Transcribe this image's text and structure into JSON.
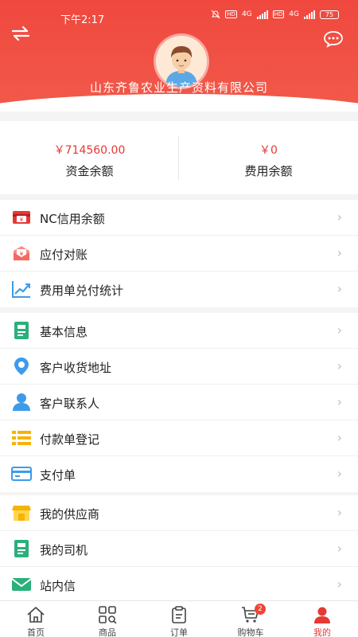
{
  "status_bar": {
    "time": "下午2:17",
    "network_a": "4G",
    "network_b": "4G",
    "battery": "75"
  },
  "profile": {
    "company_name": "山东齐鲁农业生产资料有限公司"
  },
  "balances": {
    "fund": {
      "amount": "￥714560.00",
      "label": "资金余额"
    },
    "expense": {
      "amount": "￥0",
      "label": "费用余额"
    }
  },
  "menu": {
    "group1": [
      {
        "label": "NC信用余额",
        "icon": "nc-credit-icon"
      },
      {
        "label": "应付对账",
        "icon": "payable-reconcile-icon"
      },
      {
        "label": "费用单兑付统计",
        "icon": "trend-chart-icon"
      }
    ],
    "group2": [
      {
        "label": "基本信息",
        "icon": "document-icon"
      },
      {
        "label": "客户收货地址",
        "icon": "location-pin-icon"
      },
      {
        "label": "客户联系人",
        "icon": "person-icon"
      },
      {
        "label": "付款单登记",
        "icon": "list-icon"
      },
      {
        "label": "支付单",
        "icon": "card-icon"
      }
    ],
    "group3": [
      {
        "label": "我的供应商",
        "icon": "supplier-shop-icon"
      },
      {
        "label": "我的司机",
        "icon": "driver-document-icon"
      },
      {
        "label": "站内信",
        "icon": "mail-icon"
      }
    ]
  },
  "tabbar": {
    "home": "首页",
    "products": "商品",
    "orders": "订单",
    "cart": "购物车",
    "cart_badge": "2",
    "mine": "我的"
  },
  "colors": {
    "brand_red": "#f0483e",
    "amount_red": "#e53935",
    "green": "#2ab07a",
    "blue": "#3d9be9"
  }
}
